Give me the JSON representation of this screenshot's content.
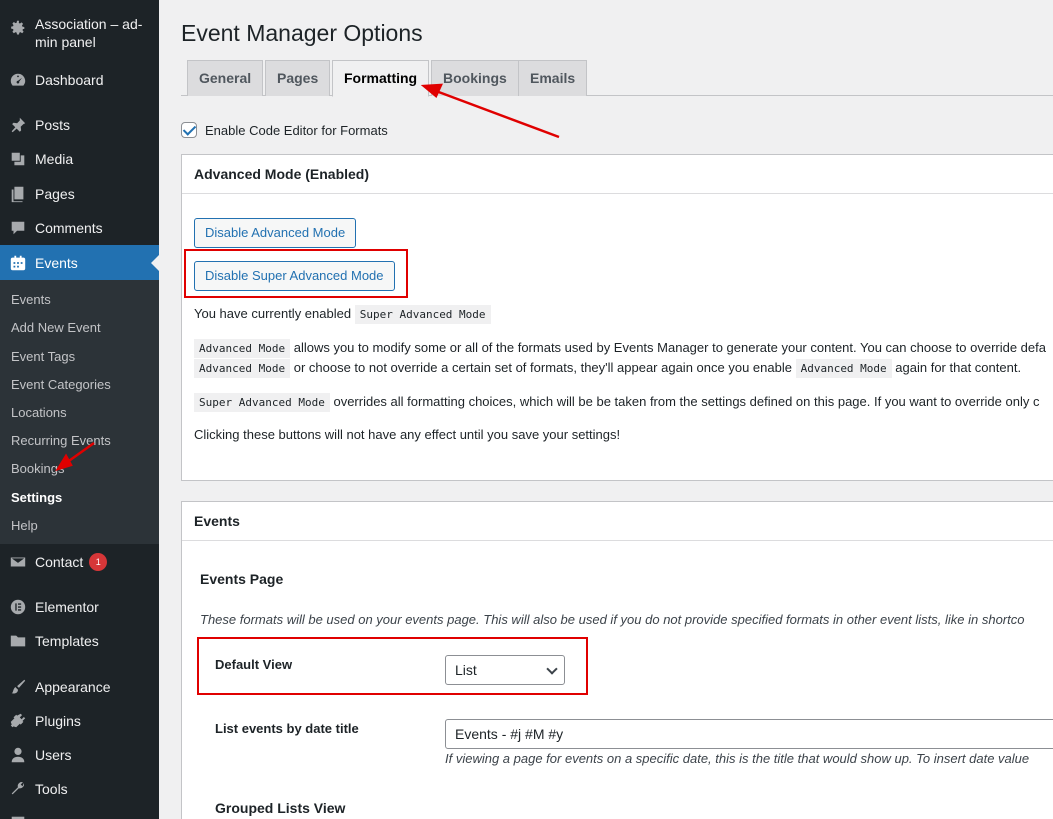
{
  "sidebar": {
    "site_title": "Association – ad-min panel",
    "site_title_line1": "Association – ad-",
    "site_title_line2": "min panel",
    "items": [
      {
        "label": "Dashboard",
        "icon": "dashboard-icon"
      },
      {
        "label": "Posts",
        "icon": "pin-icon"
      },
      {
        "label": "Media",
        "icon": "media-icon"
      },
      {
        "label": "Pages",
        "icon": "pages-icon"
      },
      {
        "label": "Comments",
        "icon": "comments-icon"
      },
      {
        "label": "Events",
        "icon": "calendar-icon"
      },
      {
        "label": "Contact",
        "icon": "mail-icon",
        "badge": "1"
      },
      {
        "label": "Elementor",
        "icon": "elementor-icon"
      },
      {
        "label": "Templates",
        "icon": "folder-icon"
      },
      {
        "label": "Appearance",
        "icon": "brush-icon"
      },
      {
        "label": "Plugins",
        "icon": "plugin-icon"
      },
      {
        "label": "Users",
        "icon": "user-icon"
      },
      {
        "label": "Tools",
        "icon": "wrench-icon"
      }
    ],
    "submenu": [
      "Events",
      "Add New Event",
      "Event Tags",
      "Event Categories",
      "Locations",
      "Recurring Events",
      "Bookings",
      "Settings",
      "Help"
    ]
  },
  "page": {
    "title": "Event Manager Options",
    "tabs": [
      "General",
      "Pages",
      "Formatting",
      "Bookings",
      "Emails"
    ],
    "active_tab": "Formatting",
    "code_editor_label": "Enable Code Editor for Formats"
  },
  "advanced": {
    "heading": "Advanced Mode (Enabled)",
    "btn_disable_advanced": "Disable Advanced Mode",
    "btn_disable_super": "Disable Super Advanced Mode",
    "p1_text": "You have currently enabled",
    "p1_code": "Super Advanced Mode",
    "p2_code1": "Advanced Mode",
    "p2_text1": "allows you to modify some or all of the formats used by Events Manager to generate your content. You can choose to override defa",
    "p2_code2": "Advanced Mode",
    "p2_text2": "or choose to not override a certain set of formats, they'll appear again once you enable",
    "p2_code3": "Advanced Mode",
    "p2_text3": "again for that content.",
    "p3_code": "Super Advanced Mode",
    "p3_text": "overrides all formatting choices, which will be be taken from the settings defined on this page. If you want to override only c",
    "p4_text": "Clicking these buttons will not have any effect until you save your settings!"
  },
  "events": {
    "heading": "Events",
    "events_page_title": "Events Page",
    "events_page_desc": "These formats will be used on your events page. This will also be used if you do not provide specified formats in other event lists, like in shortco",
    "default_view_label": "Default View",
    "default_view_value": "List",
    "list_title_label": "List events by date title",
    "list_title_value": "Events - #j #M #y",
    "list_title_desc": "If viewing a page for events on a specific date, this is the title that would show up. To insert date value",
    "grouped_title": "Grouped Lists View"
  },
  "colors": {
    "accent": "#2271b1",
    "sidebar_bg": "#1d2327",
    "annotation": "#e00000"
  }
}
